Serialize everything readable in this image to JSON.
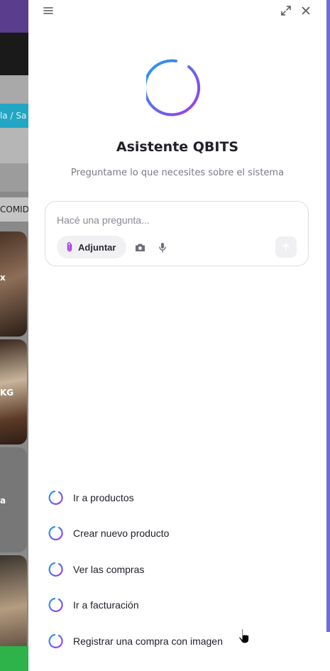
{
  "background": {
    "breadcrumb_fragment": "la / Sa",
    "category_fragment": "COMID",
    "card_labels": [
      "x",
      "KG",
      "a"
    ]
  },
  "assistant": {
    "title": "Asistente QBITS",
    "subtitle": "Preguntame lo que necesites sobre el sistema",
    "input_placeholder": "Hacé una pregunta...",
    "attach_label": "Adjuntar",
    "suggestions": [
      "Ir a productos",
      "Crear nuevo producto",
      "Ver las compras",
      "Ir a facturación",
      "Registrar una compra con imagen"
    ]
  },
  "colors": {
    "brand_gradient_start": "#1aa0f0",
    "brand_gradient_end": "#a437e8",
    "scrollbar": "#6c6ce0"
  },
  "icons": {
    "menu": "menu-icon",
    "expand": "expand-icon",
    "close": "close-icon",
    "attach": "paperclip-icon",
    "camera": "camera-icon",
    "mic": "microphone-icon",
    "send": "arrow-up-icon",
    "suggestion": "spinner-icon"
  }
}
